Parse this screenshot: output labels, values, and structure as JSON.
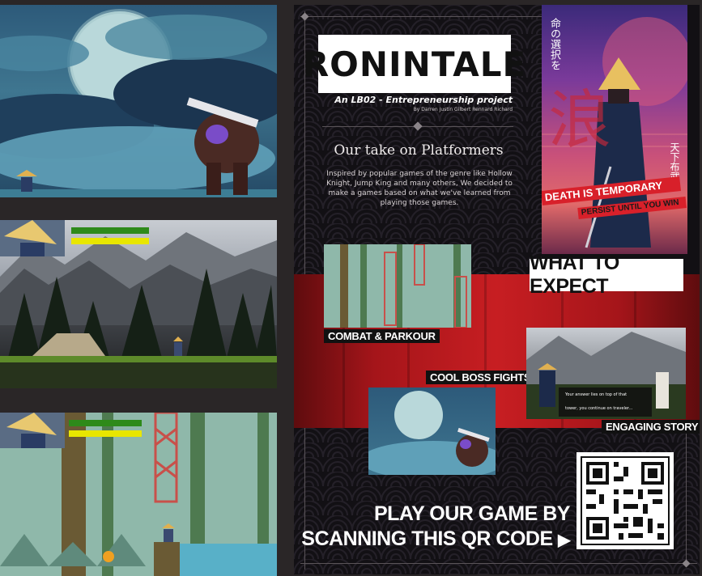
{
  "poster": {
    "logo": "RONINTALE",
    "subtitle": "An LB02 - Entrepreneurship project",
    "authors": "By Darren Justin Gilbert Rennard Richard",
    "heading": "Our take on Platformers",
    "blurb": "Inspired by popular games of the genre like Hollow Knight, Jump King and many others, We decided to make a games based on what we've learned from playing those games.",
    "cover_kanji_vertical": "命の選択を",
    "cover_kanji_right": "天下布武",
    "cover_kanji_big": "浪",
    "cover_tag1": "DEATH IS TEMPORARY",
    "cover_tag2": "PERSIST UNTIL YOU WIN",
    "what_to_expect": "WHAT TO EXPECT",
    "features": {
      "combat": "COMBAT & PARKOUR",
      "boss": "COOL BOSS FIGHTS",
      "story": "ENGAGING STORY"
    },
    "story_dialog": {
      "line1": "Your answer lies on top of that",
      "line2": "tower, you continue on traveler..."
    },
    "cta_line1": "PLAY OUR GAME BY",
    "cta_line2": "SCANNING THIS QR CODE",
    "cta_arrow": "▶"
  },
  "colors": {
    "background": "#2a2627",
    "poster_bg": "#121014",
    "red_band": "#c71e22",
    "health_green": "#2e8a1a",
    "stamina_yellow": "#e8e600",
    "cover_tag_red": "#d8202a"
  }
}
